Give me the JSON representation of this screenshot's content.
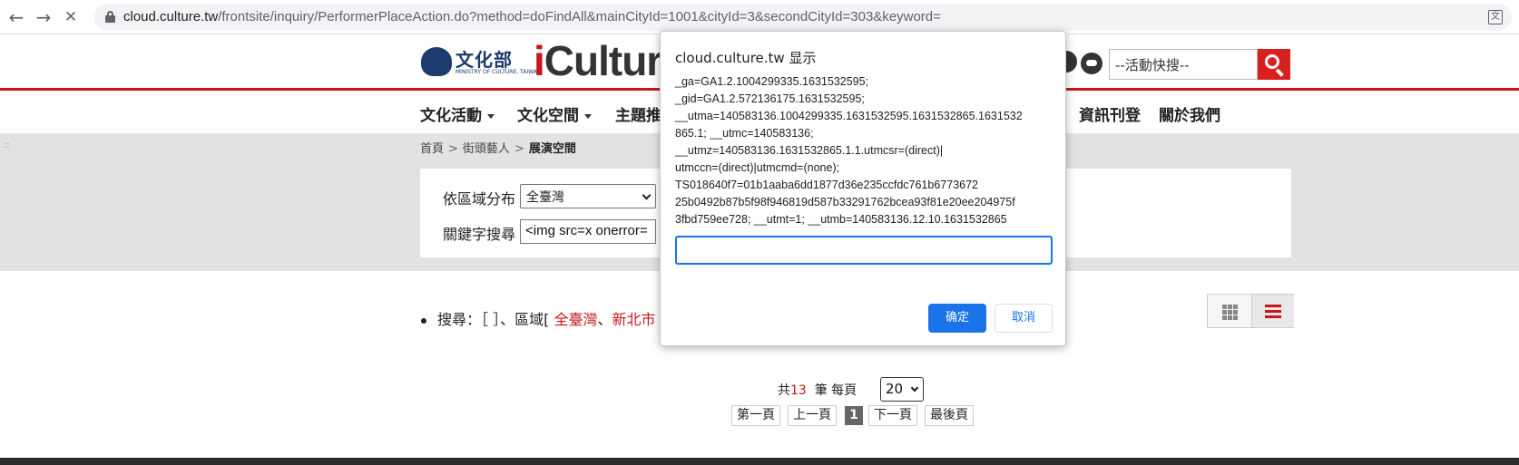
{
  "browser": {
    "url_host": "cloud.culture.tw",
    "url_path": "/frontsite/inquiry/PerformerPlaceAction.do?method=doFindAll&mainCityId=1001&cityId=3&secondCityId=303&keyword=",
    "back_icon": "←",
    "forward_icon": "→",
    "stop_icon": "✕",
    "translate_icon": "文"
  },
  "header": {
    "moc_name": "文化部",
    "moc_sub": "MINISTRY OF CULTURE, TAIWAN",
    "brand_i": "i",
    "brand_rest": "Cultur",
    "search_placeholder": "--活動快搜--",
    "accent_color": "#c8161d"
  },
  "nav": {
    "items": [
      {
        "label": "文化活動",
        "dropdown": true
      },
      {
        "label": "文化空間",
        "dropdown": true
      },
      {
        "label": "主題推",
        "dropdown": false
      },
      {
        "label": "資訊刊登",
        "dropdown": false
      },
      {
        "label": "關於我們",
        "dropdown": false
      }
    ]
  },
  "breadcrumb": {
    "home": "首頁",
    "sep": ">",
    "parent": "街頭藝人",
    "current": "展演空間"
  },
  "filters": {
    "region_label": "依區域分布",
    "region_value": "全臺灣",
    "keyword_label": "關鍵字搜尋",
    "keyword_value": "<img src=x onerror="
  },
  "results": {
    "search_prefix": "搜尋：［ ］、區域[",
    "region_1": "全臺灣",
    "region_sep": "、",
    "region_2": "新北市"
  },
  "pagination": {
    "total_prefix": "共",
    "total_count": "13",
    "total_suffix": "筆  每頁",
    "per_page": "20",
    "first": "第一頁",
    "prev": "上一頁",
    "current": "1",
    "next": "下一頁",
    "last": "最後頁"
  },
  "dialog": {
    "title": "cloud.culture.tw 显示",
    "message_lines": [
      "_ga=GA1.2.1004299335.1631532595;",
      "_gid=GA1.2.572136175.1631532595;",
      "__utma=140583136.1004299335.1631532595.1631532865.1631532",
      "865.1; __utmc=140583136;",
      "__utmz=140583136.1631532865.1.1.utmcsr=(direct)|",
      "utmccn=(direct)|utmcmd=(none);",
      "TS018640f7=01b1aaba6dd1877d36e235ccfdc761b6773672",
      "25b0492b87b5f98f946819d587b33291762bcea93f81e20ee204975f",
      "3fbd759ee728; __utmt=1; __utmb=140583136.12.10.1631532865"
    ],
    "input_value": "",
    "ok_label": "确定",
    "cancel_label": "取消"
  }
}
